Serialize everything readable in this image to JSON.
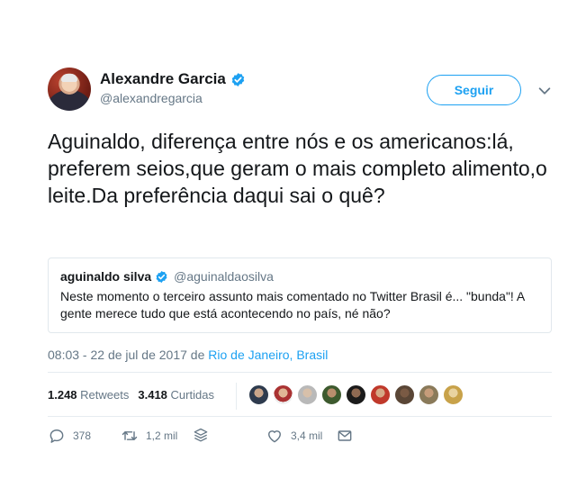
{
  "author": {
    "name": "Alexandre Garcia",
    "handle": "@alexandregarcia"
  },
  "follow_label": "Seguir",
  "tweet_text": "Aguinaldo, diferença entre nós e os americanos:lá, preferem seios,que geram o mais completo alimento,o leite.Da preferência daqui sai o quê?",
  "quote": {
    "name": "aguinaldo silva",
    "handle": "@aguinaldaosilva",
    "text": "Neste momento o terceiro assunto mais comentado no Twitter Brasil é... \"bunda\"! A gente merece tudo que está acontecendo no país, né não?"
  },
  "meta": {
    "time": "08:03 - 22 de jul de 2017 de ",
    "location": "Rio de Janeiro, Brasil"
  },
  "stats": {
    "retweets_count": "1.248",
    "retweets_label": "Retweets",
    "likes_count": "3.418",
    "likes_label": "Curtidas"
  },
  "actions": {
    "replies": "378",
    "retweets": "1,2 mil",
    "likes": "3,4 mil"
  },
  "colors": {
    "accent": "#1da1f2",
    "text": "#14171a",
    "muted": "#657786"
  },
  "icons": [
    "verified-icon",
    "chevron-down-icon",
    "reply-icon",
    "retweet-icon",
    "layers-icon",
    "like-icon",
    "message-icon"
  ]
}
